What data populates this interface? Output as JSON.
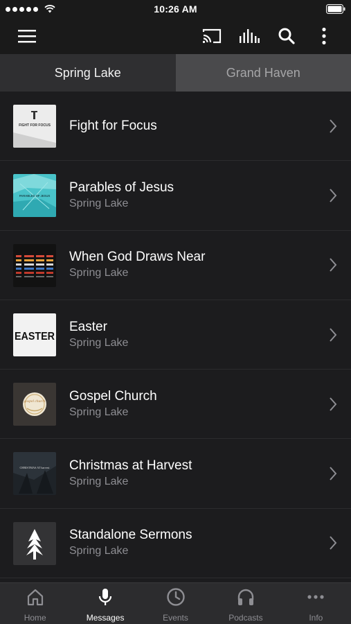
{
  "status_bar": {
    "time": "10:26 AM"
  },
  "toolbar": {
    "icons": [
      "menu-icon",
      "cast-icon",
      "audio-bars-icon",
      "search-icon",
      "more-vertical-icon"
    ]
  },
  "tabs": [
    {
      "label": "Spring Lake",
      "active": true
    },
    {
      "label": "Grand Haven",
      "active": false
    }
  ],
  "series": [
    {
      "title": "Fight for Focus",
      "subtitle": "",
      "thumb_text": "FIGHT FOR FOCUS"
    },
    {
      "title": "Parables of Jesus",
      "subtitle": "Spring Lake",
      "thumb_text": "PARABLES OF JESUS"
    },
    {
      "title": "When God Draws Near",
      "subtitle": "Spring Lake",
      "thumb_text": ""
    },
    {
      "title": "Easter",
      "subtitle": "Spring Lake",
      "thumb_text": "EASTER"
    },
    {
      "title": "Gospel Church",
      "subtitle": "Spring Lake",
      "thumb_text": "gospel church"
    },
    {
      "title": "Christmas at Harvest",
      "subtitle": "Spring Lake",
      "thumb_text": "CHRISTMAS AT harvest"
    },
    {
      "title": "Standalone Sermons",
      "subtitle": "Spring Lake",
      "thumb_text": ""
    }
  ],
  "bottom_nav": [
    {
      "label": "Home",
      "icon": "home-icon",
      "active": false
    },
    {
      "label": "Messages",
      "icon": "microphone-icon",
      "active": true
    },
    {
      "label": "Events",
      "icon": "clock-icon",
      "active": false
    },
    {
      "label": "Podcasts",
      "icon": "headphones-icon",
      "active": false
    },
    {
      "label": "Info",
      "icon": "more-horizontal-icon",
      "active": false
    }
  ],
  "colors": {
    "background": "#1c1c1e",
    "active_tab": "#2f2f31",
    "inactive_tab": "#4a4a4c",
    "nav_bar": "#2c2c2e",
    "subtitle": "#8e8e93"
  }
}
